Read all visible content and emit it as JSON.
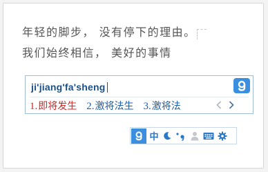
{
  "document": {
    "line1": "年轻的脚步， 没有停下的理由。",
    "line2": "我们始终相信， 美好的事情"
  },
  "ime": {
    "composition": "ji'jiang'fa'sheng",
    "candidates": [
      {
        "num": "1.",
        "text": "即将发生"
      },
      {
        "num": "2.",
        "text": "激将法生"
      },
      {
        "num": "3.",
        "text": "激将法"
      }
    ],
    "prev_page_icon": "chevron-left-icon",
    "next_page_icon": "chevron-right-icon"
  },
  "toolbar": {
    "logo_icon": "sogou-logo-icon",
    "lang_label": "中",
    "items": [
      "half-moon-icon",
      "punctuation-icon",
      "user-icon",
      "keyboard-icon",
      "settings-icon"
    ]
  },
  "colors": {
    "accent": "#3c8fde",
    "candidate_first": "#c82a26",
    "candidate": "#1c5fa8",
    "composition": "#1c4f86"
  }
}
